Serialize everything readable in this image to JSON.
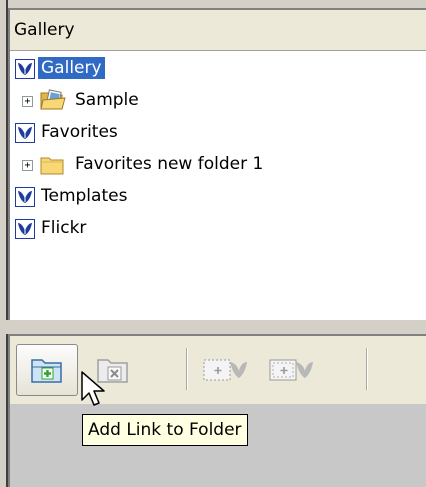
{
  "panel": {
    "title": "Gallery"
  },
  "tree": {
    "items": [
      {
        "label": "Gallery",
        "icon": "butterfly-app-icon",
        "selected": true
      },
      {
        "label": "Sample",
        "icon": "open-folder-photos-icon",
        "expander": "+"
      },
      {
        "label": "Favorites",
        "icon": "butterfly-app-icon"
      },
      {
        "label": "Favorites new folder 1",
        "icon": "folder-icon",
        "expander": "+"
      },
      {
        "label": "Templates",
        "icon": "butterfly-app-icon"
      },
      {
        "label": "Flickr",
        "icon": "butterfly-app-icon"
      }
    ]
  },
  "toolbar": {
    "buttons": [
      {
        "name": "add-link-to-folder",
        "icon": "folder-add-icon",
        "enabled": true,
        "hot": true
      },
      {
        "name": "remove-link",
        "icon": "folder-remove-icon",
        "enabled": false
      },
      {
        "name": "add-image",
        "icon": "add-image-butterfly-icon",
        "enabled": false
      },
      {
        "name": "add-images",
        "icon": "add-images-butterfly-icon",
        "enabled": false
      }
    ]
  },
  "tooltip": {
    "text": "Add Link to Folder"
  },
  "colors": {
    "selection": "#316ac5",
    "tooltip_bg": "#ffffe1",
    "app_icon_blue": "#1f3c9c",
    "folder_yellow": "#f8d775",
    "add_green": "#2aa82a"
  }
}
